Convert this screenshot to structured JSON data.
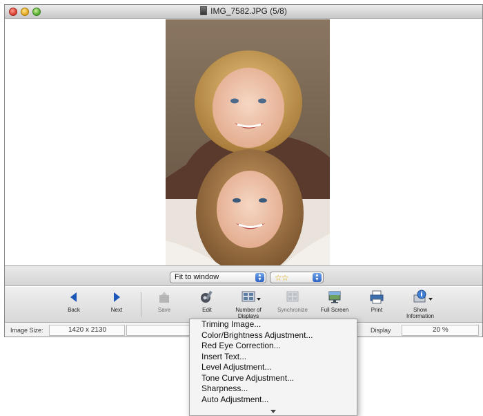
{
  "window": {
    "title": "IMG_7582.JPG (5/8)",
    "title_icon": "image-file-icon"
  },
  "controls": {
    "fit_value": "Fit to window",
    "rating_value": "☆☆",
    "rating_stars": 2
  },
  "toolbar": {
    "back": "Back",
    "next": "Next",
    "save": "Save",
    "edit": "Edit",
    "displays_line1": "Number of",
    "displays_line2": "Displays",
    "synchronize": "Synchronize",
    "fullscreen": "Full Screen",
    "print": "Print",
    "info_line1": "Show",
    "info_line2": "Information"
  },
  "status": {
    "image_size_label": "Image Size:",
    "image_size_value": "1420 x 2130",
    "display_label": "Display",
    "display_value": "20 %"
  },
  "edit_menu": {
    "items": [
      "Triming Image...",
      "Color/Brightness Adjustment...",
      "Red Eye Correction...",
      "Insert Text...",
      "Level Adjustment...",
      "Tone Curve Adjustment...",
      "Sharpness...",
      "Auto Adjustment..."
    ]
  },
  "colors": {
    "accent_blue": "#2f63c4",
    "star_gold": "#d9a700"
  }
}
